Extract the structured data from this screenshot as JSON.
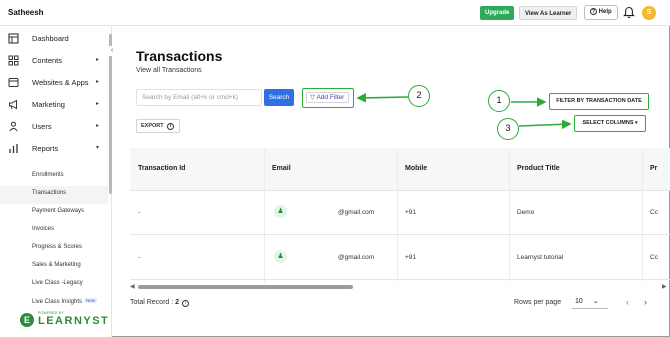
{
  "header": {
    "brand": "Satheesh",
    "upgrade": "Upgrade",
    "view_as_learner": "View As Learner",
    "help": "Help",
    "avatar_initial": "S"
  },
  "sidebar": {
    "items": [
      {
        "label": "Dashboard",
        "icon": "layout-icon"
      },
      {
        "label": "Contents",
        "icon": "grid-icon"
      },
      {
        "label": "Websites & Apps",
        "icon": "browser-icon"
      },
      {
        "label": "Marketing",
        "icon": "megaphone-icon"
      },
      {
        "label": "Users",
        "icon": "user-icon"
      },
      {
        "label": "Reports",
        "icon": "bar-chart-icon"
      }
    ],
    "sub_items": [
      "Enrollments",
      "Transactions",
      "Payment Gateways",
      "Invoices",
      "Progress & Scores",
      "Sales & Marketing",
      "Live Class -Legacy",
      "Live Class Insights"
    ],
    "new_badge": "New",
    "logo_pre": "POWERED BY",
    "logo_text": "LEARNYST",
    "logo_mark": "E"
  },
  "page": {
    "title": "Transactions",
    "subtitle": "View all Transactions"
  },
  "toolbar": {
    "search_placeholder": "Search by Email (alt+k or cmd+k)",
    "search_button": "Search",
    "add_filter": "Add Filter",
    "export": "EXPORT",
    "filter_by_date": "FILTER BY TRANSACTION DATE",
    "select_columns": "SELECT COLUMNS"
  },
  "callouts": [
    "1",
    "2",
    "3"
  ],
  "table": {
    "headers": [
      "Transaction Id",
      "Email",
      "Mobile",
      "Product Title",
      "Pr"
    ],
    "rows": [
      {
        "id": "-",
        "email": "@gmail.com",
        "mobile": "+91",
        "product": "Demo",
        "pr": "Cc"
      },
      {
        "id": "-",
        "email": "@gmail.com",
        "mobile": "+91",
        "product": "Learnyst tutorial",
        "pr": "Cc"
      }
    ]
  },
  "footer": {
    "total_label": "Total Record : ",
    "total_value": "2",
    "rows_per_page_label": "Rows per page",
    "rows_per_page_value": "10"
  },
  "colors": {
    "accent_green": "#2eaa3a",
    "primary_blue": "#2f6fe4",
    "avatar": "#f5b82e"
  }
}
